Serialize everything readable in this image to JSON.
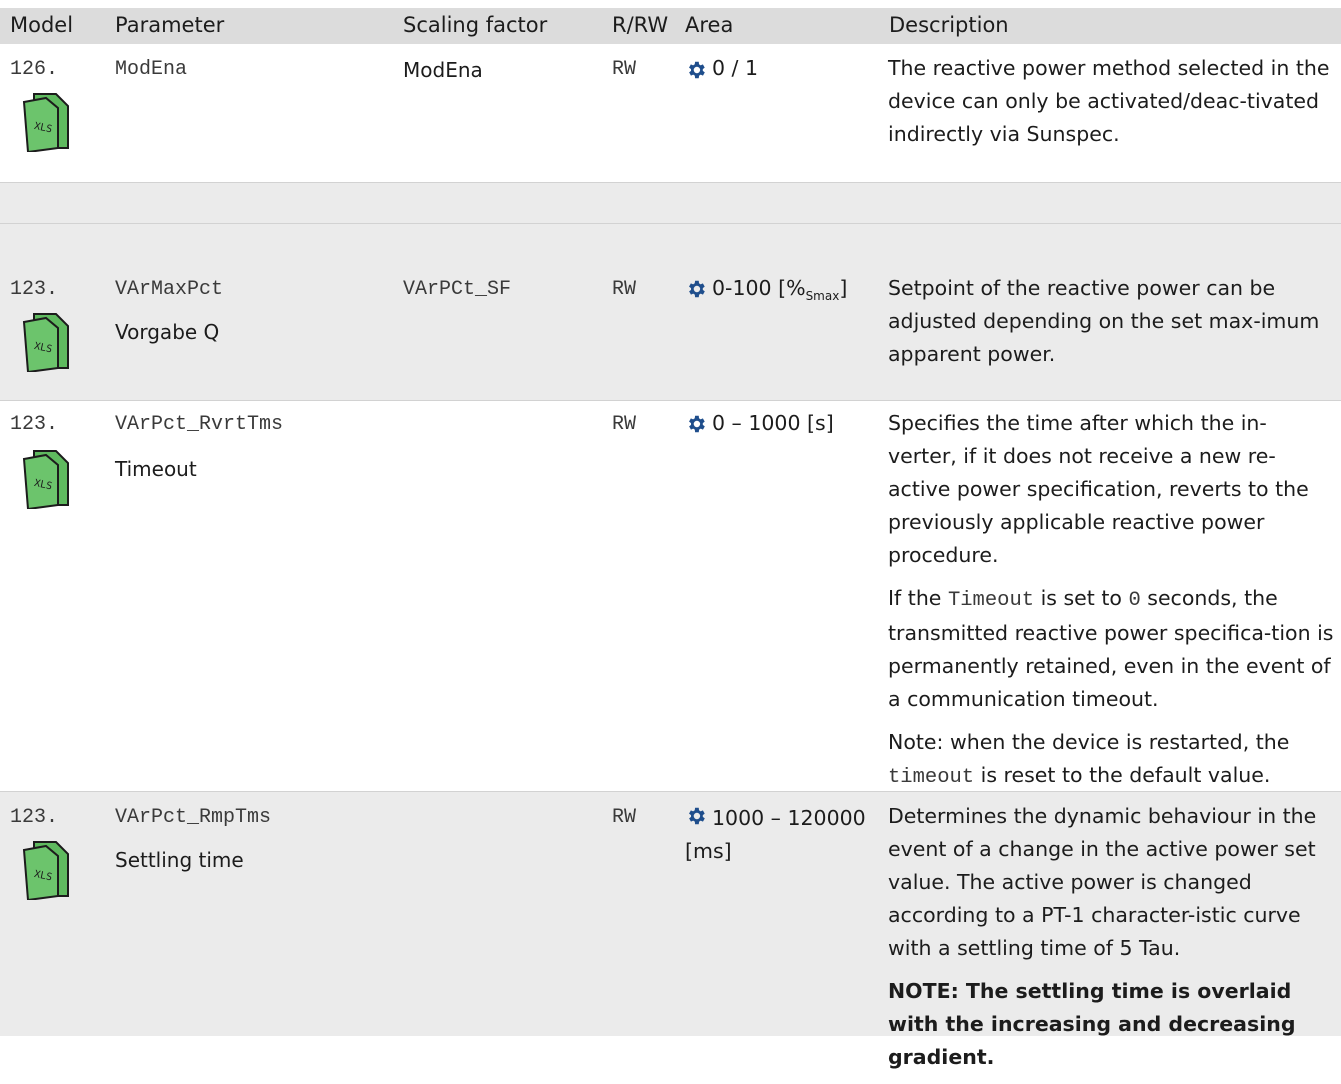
{
  "header": {
    "model": "Model",
    "parameter": "Parameter",
    "scaling": "Scaling factor",
    "rrw": "R/RW",
    "area": "Area",
    "description": "Description"
  },
  "icons": {
    "settings": "gear-icon",
    "file": "xls-file-icon"
  },
  "colors": {
    "xls_green": "#5fba5f",
    "gear_blue": "#1f4e8c",
    "header_bg": "#dcdcdc",
    "grey_row": "#ebebeb"
  },
  "rows": [
    {
      "model": "126.",
      "file_label": "XLS",
      "parameter": "ModEna",
      "scaling": "ModEna",
      "rrw": "RW",
      "area": "0 / 1",
      "desc": [
        "The reactive power method selected in the device can only be activated/deac-tivated indirectly via Sunspec."
      ]
    },
    {
      "model": "123.",
      "file_label": "XLS",
      "parameter": "VArMaxPct",
      "parameter_sub": "Vorgabe Q",
      "scaling": "VArPCt_SF",
      "rrw": "RW",
      "area": "0-100 [%",
      "area_sub": "Smax",
      "area_end": "]",
      "desc": [
        "Setpoint of the reactive power can be adjusted depending on the set max-imum apparent power."
      ]
    },
    {
      "model": "123.",
      "file_label": "XLS",
      "parameter": "VArPct_RvrtTms",
      "parameter_sub": "Timeout",
      "rrw": "RW",
      "area": "0 – 1000 [s]",
      "desc": [
        "Specifies the time after which the in-verter, if it does not receive a new re-active power specification, reverts to the previously applicable reactive power procedure.",
        "If the ",
        "Timeout",
        " is set to ",
        "0",
        " seconds, the transmitted reactive power specifica-tion is permanently retained, even in the event of a communication timeout.",
        "Note: when the device is restarted, the ",
        "timeout",
        " is reset to the default value."
      ]
    },
    {
      "model": "123.",
      "file_label": "XLS",
      "parameter": "VArPct_RmpTms",
      "parameter_sub": "Settling time",
      "rrw": "RW",
      "area": "1000 – 120000 [ms]",
      "desc": [
        "Determines the dynamic behaviour in the event of a change in the active power set value. The active power is changed according to a PT-1 character-istic curve with a settling time of 5 Tau.",
        "NOTE: The settling time is overlaid with the increasing and decreasing gradient."
      ]
    }
  ]
}
